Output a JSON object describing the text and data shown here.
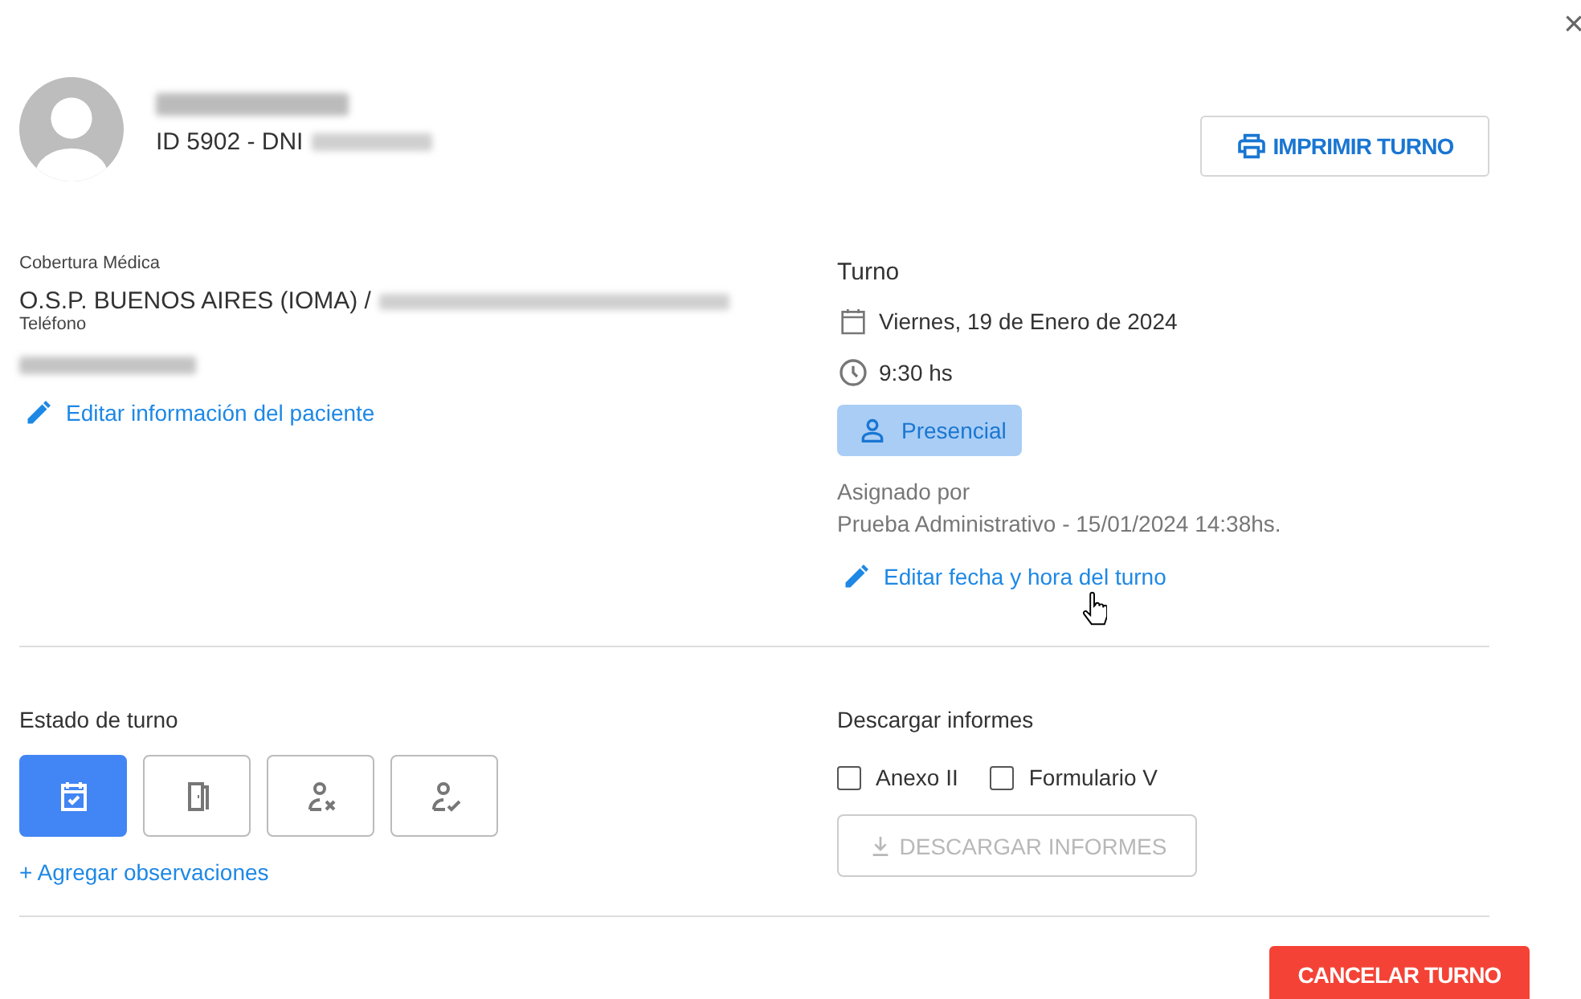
{
  "close": "×",
  "patient": {
    "id_line": "ID 5902 - DNI"
  },
  "print_button": "IMPRIMIR TURNO",
  "coverage": {
    "label": "Cobertura Médica",
    "value": "O.S.P. BUENOS AIRES (IOMA) /"
  },
  "phone": {
    "label": "Teléfono"
  },
  "edit_patient_link": "Editar información del paciente",
  "appointment": {
    "title": "Turno",
    "date": "Viernes, 19 de Enero de 2024",
    "time": "9:30 hs",
    "mode": "Presencial",
    "assigned_label": "Asignado por",
    "assigned_value": "Prueba Administrativo - 15/01/2024 14:38hs.",
    "edit_link": "Editar fecha y hora del turno"
  },
  "status": {
    "title": "Estado de turno",
    "buttons": [
      {
        "kind": "scheduled",
        "selected": true
      },
      {
        "kind": "arrived",
        "selected": false
      },
      {
        "kind": "absent",
        "selected": false
      },
      {
        "kind": "attended",
        "selected": false
      }
    ],
    "add_notes_link": "+ Agregar observaciones"
  },
  "reports": {
    "title": "Descargar informes",
    "options": [
      {
        "label": "Anexo II",
        "checked": false
      },
      {
        "label": "Formulario V",
        "checked": false
      }
    ],
    "download_button": {
      "label": "DESCARGAR INFORMES",
      "disabled": true
    }
  },
  "cancel_button": "CANCELAR TURNO"
}
